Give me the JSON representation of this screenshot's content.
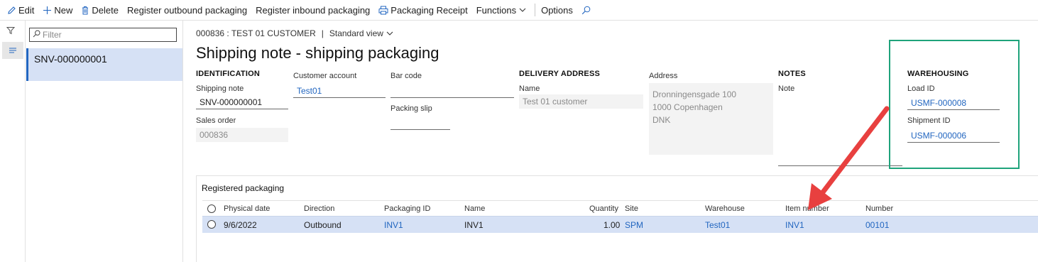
{
  "actionbar": {
    "edit": "Edit",
    "new": "New",
    "delete": "Delete",
    "register_outbound": "Register outbound packaging",
    "register_inbound": "Register inbound packaging",
    "packaging_receipt": "Packaging Receipt",
    "functions": "Functions",
    "options": "Options"
  },
  "listpane": {
    "filter_placeholder": "Filter",
    "items": [
      "SNV-000000001"
    ]
  },
  "caption": {
    "record": "000836 : TEST 01 CUSTOMER",
    "view": "Standard view"
  },
  "page_title": "Shipping note - shipping packaging",
  "identification": {
    "heading": "IDENTIFICATION",
    "shipping_note_label": "Shipping note",
    "shipping_note_value": "SNV-000000001",
    "sales_order_label": "Sales order",
    "sales_order_value": "000836",
    "customer_account_label": "Customer account",
    "customer_account_value": "Test01",
    "bar_code_label": "Bar code",
    "bar_code_value": "",
    "packing_slip_label": "Packing slip",
    "packing_slip_value": ""
  },
  "delivery_address": {
    "heading": "DELIVERY ADDRESS",
    "name_label": "Name",
    "name_value": "Test 01 customer",
    "address_label": "Address",
    "address_lines": [
      "Dronningensgade 100",
      "1000 Copenhagen",
      "DNK"
    ]
  },
  "notes": {
    "heading": "NOTES",
    "note_label": "Note",
    "note_value": ""
  },
  "warehousing": {
    "heading": "WAREHOUSING",
    "load_id_label": "Load ID",
    "load_id_value": "USMF-000008",
    "shipment_id_label": "Shipment ID",
    "shipment_id_value": "USMF-000006"
  },
  "grid": {
    "title": "Registered packaging",
    "columns": [
      "Physical date",
      "Direction",
      "Packaging ID",
      "Name",
      "Quantity",
      "Site",
      "Warehouse",
      "Item number",
      "Number"
    ],
    "rows": [
      {
        "physical_date": "9/6/2022",
        "direction": "Outbound",
        "packaging_id": "INV1",
        "name": "INV1",
        "quantity": "1.00",
        "site": "SPM",
        "warehouse": "Test01",
        "item_number": "INV1",
        "number": "00101"
      }
    ]
  },
  "colors": {
    "link": "#2266c0",
    "selected_row": "#d6e1f5",
    "highlight_box": "#1fa37b",
    "arrow": "#e8403f"
  }
}
